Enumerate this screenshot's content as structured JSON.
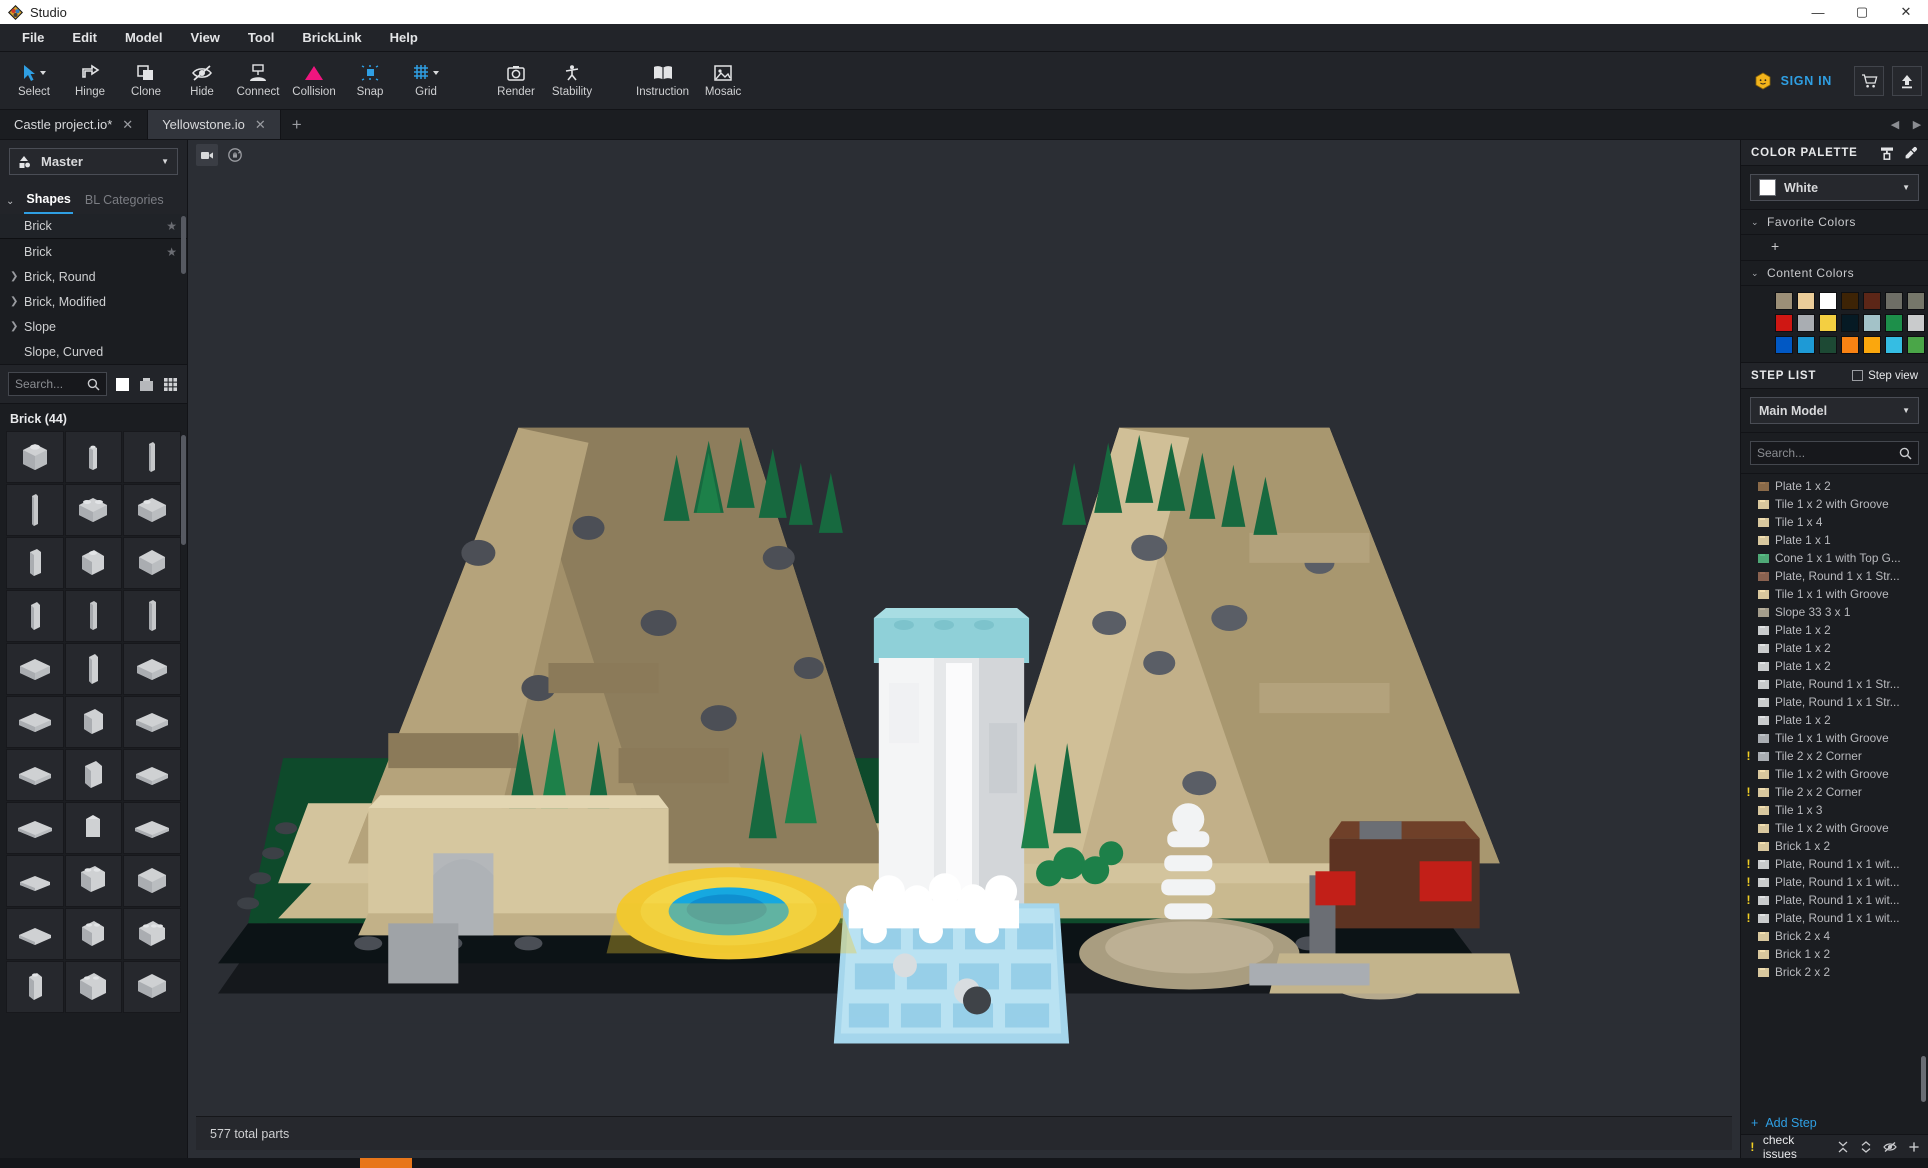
{
  "window": {
    "title": "Studio",
    "minimize": "—",
    "maximize": "▢",
    "close": "✕"
  },
  "menubar": {
    "items": [
      "File",
      "Edit",
      "Model",
      "View",
      "Tool",
      "BrickLink",
      "Help"
    ]
  },
  "toolbar": {
    "items": [
      {
        "label": "Select",
        "icon": "cursor-arrow-icon",
        "has_caret": true,
        "color": "#2f9fe3"
      },
      {
        "label": "Hinge",
        "icon": "hinge-icon",
        "has_caret": false,
        "color": "#e3e4e6"
      },
      {
        "label": "Clone",
        "icon": "clone-icon",
        "has_caret": false,
        "color": "#e3e4e6"
      },
      {
        "label": "Hide",
        "icon": "eye-slash-icon",
        "has_caret": false,
        "color": "#e3e4e6"
      },
      {
        "label": "Connect",
        "icon": "connect-icon",
        "has_caret": false,
        "color": "#e3e4e6"
      },
      {
        "label": "Collision",
        "icon": "warning-triangle-icon",
        "has_caret": false,
        "color": "#f0157f"
      },
      {
        "label": "Snap",
        "icon": "snap-icon",
        "has_caret": false,
        "color": "#2f9fe3"
      },
      {
        "label": "Grid",
        "icon": "grid-icon",
        "has_caret": true,
        "color": "#2f9fe3"
      },
      {
        "label": "Render",
        "icon": "camera-icon",
        "has_caret": false,
        "color": "#e3e4e6"
      },
      {
        "label": "Stability",
        "icon": "stability-icon",
        "has_caret": false,
        "color": "#e3e4e6"
      },
      {
        "label": "Instruction",
        "icon": "book-icon",
        "has_caret": false,
        "color": "#e3e4e6"
      },
      {
        "label": "Mosaic",
        "icon": "mosaic-icon",
        "has_caret": false,
        "color": "#e3e4e6"
      }
    ],
    "sign_in": "SIGN IN",
    "cart_icon": "cart-icon",
    "upload_icon": "upload-icon"
  },
  "tabs": {
    "items": [
      {
        "label": "Castle project.io*",
        "active": false
      },
      {
        "label": "Yellowstone.io",
        "active": true
      }
    ],
    "new_tab": "+",
    "nav_prev": "◀",
    "nav_next": "▶"
  },
  "left_panel": {
    "master_select": "Master",
    "shape_tabs": [
      {
        "label": "Shapes",
        "active": true
      },
      {
        "label": "BL Categories",
        "active": false
      }
    ],
    "categories": [
      {
        "label": "Brick",
        "expandable": false,
        "star": true,
        "selected": true
      },
      {
        "label": "Brick",
        "expandable": false,
        "star": true,
        "selected": false
      },
      {
        "label": "Brick, Round",
        "expandable": true,
        "star": false,
        "selected": false
      },
      {
        "label": "Brick, Modified",
        "expandable": true,
        "star": false,
        "selected": false
      },
      {
        "label": "Slope",
        "expandable": true,
        "star": false,
        "selected": false
      },
      {
        "label": "Slope, Curved",
        "expandable": false,
        "star": false,
        "selected": false
      }
    ],
    "search_placeholder": "Search...",
    "part_group_title": "Brick (44)",
    "view_toggle_flat": "flat-view-icon",
    "view_toggle_brick": "brick-view-icon",
    "view_toggle_grid": "grid-view-icon"
  },
  "viewport": {
    "camera_icon": "camera-view-icon",
    "rotate_icon": "rotate-lock-icon",
    "status": "577 total parts"
  },
  "color_palette": {
    "title": "COLOR PALETTE",
    "brush_icon": "paint-roller-icon",
    "dropper_icon": "eyedropper-icon",
    "selected_color": "White",
    "favorite_colors_label": "Favorite Colors",
    "favorite_add": "+",
    "content_colors_label": "Content Colors",
    "content_colors": [
      "#9c8f77",
      "#ebcd99",
      "#ffffff",
      "#3d2305",
      "#5c2617",
      "#6e6e66",
      "#76776a",
      "#cf1713",
      "#a9adb2",
      "#f4cf41",
      "#061a24",
      "#a3c2c8",
      "#1d8f4a",
      "#c9cbcc",
      "#0158c4",
      "#1e9ad6",
      "#1d4934",
      "#f98213",
      "#fba70d",
      "#35bde3",
      "#4aa648"
    ]
  },
  "step_list": {
    "title": "STEP LIST",
    "step_view_label": "Step view",
    "step_view_checked": false,
    "model_select": "Main Model",
    "search_placeholder": "Search...",
    "steps": [
      {
        "label": "Plate 1 x 2",
        "color": "#8a6a49",
        "warn": false
      },
      {
        "label": "Tile 1 x 2 with Groove",
        "color": "#d8c79e",
        "warn": false
      },
      {
        "label": "Tile 1 x 4",
        "color": "#d8c79e",
        "warn": false
      },
      {
        "label": "Plate 1 x 1",
        "color": "#d8c79e",
        "warn": false
      },
      {
        "label": "Cone 1 x 1 with Top G...",
        "color": "#4fa876",
        "warn": false
      },
      {
        "label": "Plate, Round 1 x 1 Str...",
        "color": "#8a6250",
        "warn": false
      },
      {
        "label": "Tile 1 x 1 with Groove",
        "color": "#d8c79e",
        "warn": false
      },
      {
        "label": "Slope 33 3 x 1",
        "color": "#a49d8c",
        "warn": false
      },
      {
        "label": "Plate 1 x 2",
        "color": "#c9cbcc",
        "warn": false
      },
      {
        "label": "Plate 1 x 2",
        "color": "#c9cbcc",
        "warn": false
      },
      {
        "label": "Plate 1 x 2",
        "color": "#c9cbcc",
        "warn": false
      },
      {
        "label": "Plate, Round 1 x 1 Str...",
        "color": "#c9cbcc",
        "warn": false
      },
      {
        "label": "Plate, Round 1 x 1 Str...",
        "color": "#c9cbcc",
        "warn": false
      },
      {
        "label": "Plate 1 x 2",
        "color": "#c9cbcc",
        "warn": false
      },
      {
        "label": "Tile 1 x 1 with Groove",
        "color": "#a9adb2",
        "warn": false
      },
      {
        "label": "Tile 2 x 2 Corner",
        "color": "#a9adb2",
        "warn": true
      },
      {
        "label": "Tile 1 x 2 with Groove",
        "color": "#d8c79e",
        "warn": false
      },
      {
        "label": "Tile 2 x 2 Corner",
        "color": "#d8c79e",
        "warn": true
      },
      {
        "label": "Tile 1 x 3",
        "color": "#d8c79e",
        "warn": false
      },
      {
        "label": "Tile 1 x 2 with Groove",
        "color": "#d8c79e",
        "warn": false
      },
      {
        "label": "Brick 1 x 2",
        "color": "#d8c79e",
        "warn": false
      },
      {
        "label": "Plate, Round 1 x 1 wit...",
        "color": "#c9cbcc",
        "warn": true
      },
      {
        "label": "Plate, Round 1 x 1 wit...",
        "color": "#c9cbcc",
        "warn": true
      },
      {
        "label": "Plate, Round 1 x 1 wit...",
        "color": "#c9cbcc",
        "warn": true
      },
      {
        "label": "Plate, Round 1 x 1 wit...",
        "color": "#c9cbcc",
        "warn": true
      },
      {
        "label": "Brick 2 x 4",
        "color": "#d8c79e",
        "warn": false
      },
      {
        "label": "Brick 1 x 2",
        "color": "#d8c79e",
        "warn": false
      },
      {
        "label": "Brick 2 x 2",
        "color": "#d8c79e",
        "warn": false
      }
    ],
    "add_step": "Add Step",
    "add_step_plus": "+"
  },
  "issue_bar": {
    "label": "check issues",
    "warn_glyph": "!",
    "collapse_icon": "collapse-icon",
    "updown_icon": "sort-updown-icon",
    "hide_icon": "eye-slash-icon",
    "add_icon": "plus-icon"
  },
  "theme": {
    "accent": "#2f9fe3",
    "panel_bg": "#1b1d21",
    "toolbar_bg": "#222429",
    "viewport_bg": "#2b2e34",
    "warn": "#f2d024",
    "collision": "#f0157f"
  }
}
